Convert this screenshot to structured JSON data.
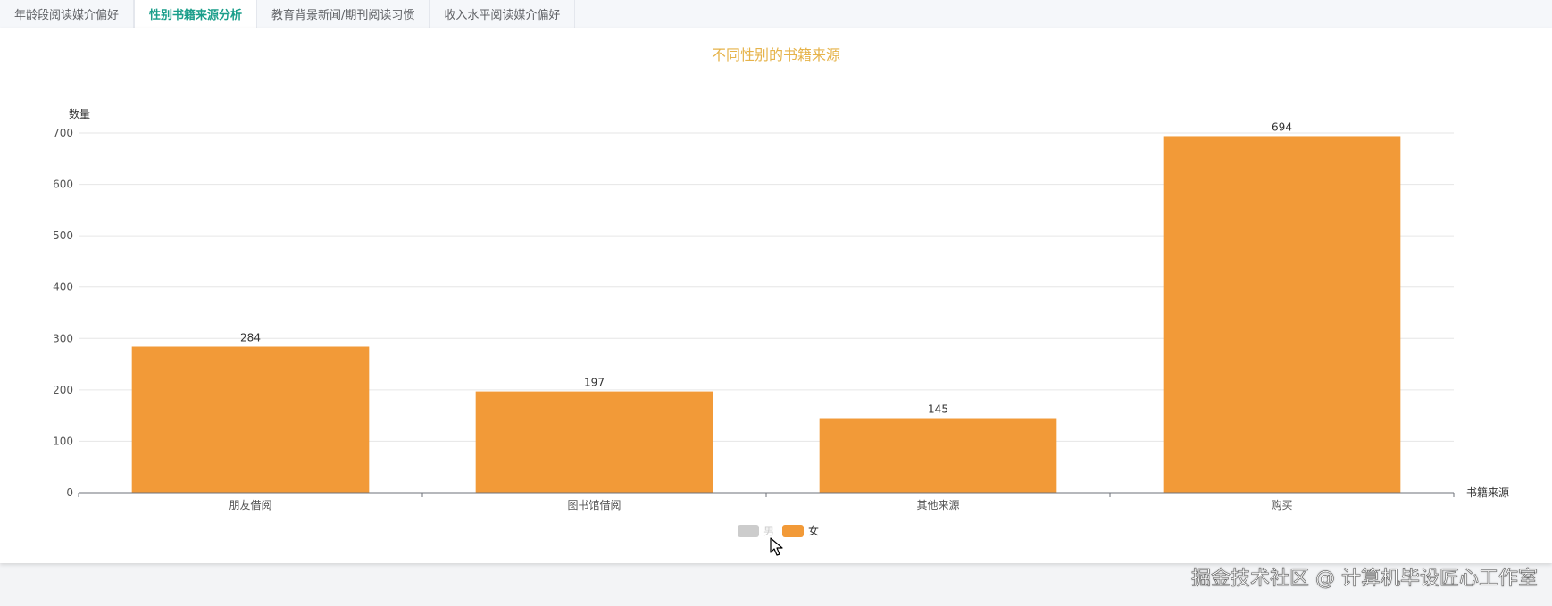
{
  "tabs": [
    {
      "label": "年龄段阅读媒介偏好",
      "active": false
    },
    {
      "label": "性别书籍来源分析",
      "active": true
    },
    {
      "label": "教育背景新闻/期刊阅读习惯",
      "active": false
    },
    {
      "label": "收入水平阅读媒介偏好",
      "active": false
    }
  ],
  "chart_data": {
    "type": "bar",
    "title": "不同性别的书籍来源",
    "ylabel": "数量",
    "xlabel": "书籍来源",
    "categories": [
      "朋友借阅",
      "图书馆借阅",
      "其他来源",
      "购买"
    ],
    "ylim": [
      0,
      700
    ],
    "yticks": [
      0,
      100,
      200,
      300,
      400,
      500,
      600,
      700
    ],
    "grid": true,
    "legend_position": "bottom-center",
    "series": [
      {
        "name": "男",
        "values": [],
        "color": "#bfbfbf",
        "visible": false
      },
      {
        "name": "女",
        "values": [
          284,
          197,
          145,
          694
        ],
        "color": "#f29a38",
        "visible": true
      }
    ]
  },
  "watermark": "掘金技术社区 @ 计算机毕设匠心工作室"
}
